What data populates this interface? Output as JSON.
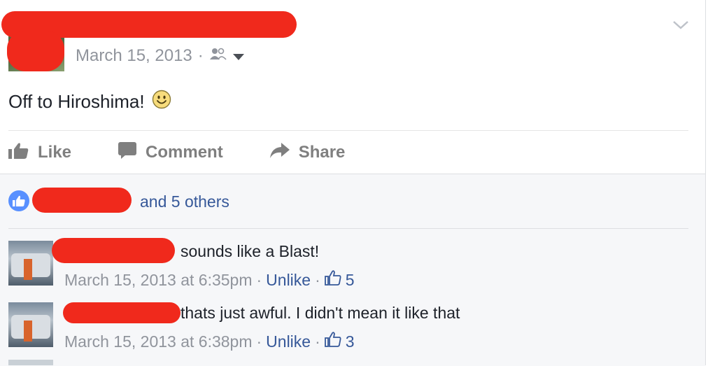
{
  "post": {
    "date": "March 15, 2013",
    "separator": "·",
    "text": "Off to Hiroshima!",
    "emoji": "smile-emoji-icon"
  },
  "actions": {
    "like_label": "Like",
    "comment_label": "Comment",
    "share_label": "Share"
  },
  "likes": {
    "others_text": "and 5 others"
  },
  "comments": [
    {
      "text": "sounds like a Blast!",
      "time": "March 15, 2013 at 6:35pm",
      "sep": "·",
      "unlike": "Unlike",
      "sep2": "·",
      "count": "5"
    },
    {
      "text": "thats just awful. I didn't mean it like that",
      "time": "March 15, 2013 at 6:38pm",
      "sep": "·",
      "unlike": "Unlike",
      "sep2": "·",
      "count": "3"
    }
  ],
  "colors": {
    "link": "#365899",
    "meta": "#90949c",
    "redaction": "#f0291c",
    "like_badge": "#5890ff"
  }
}
